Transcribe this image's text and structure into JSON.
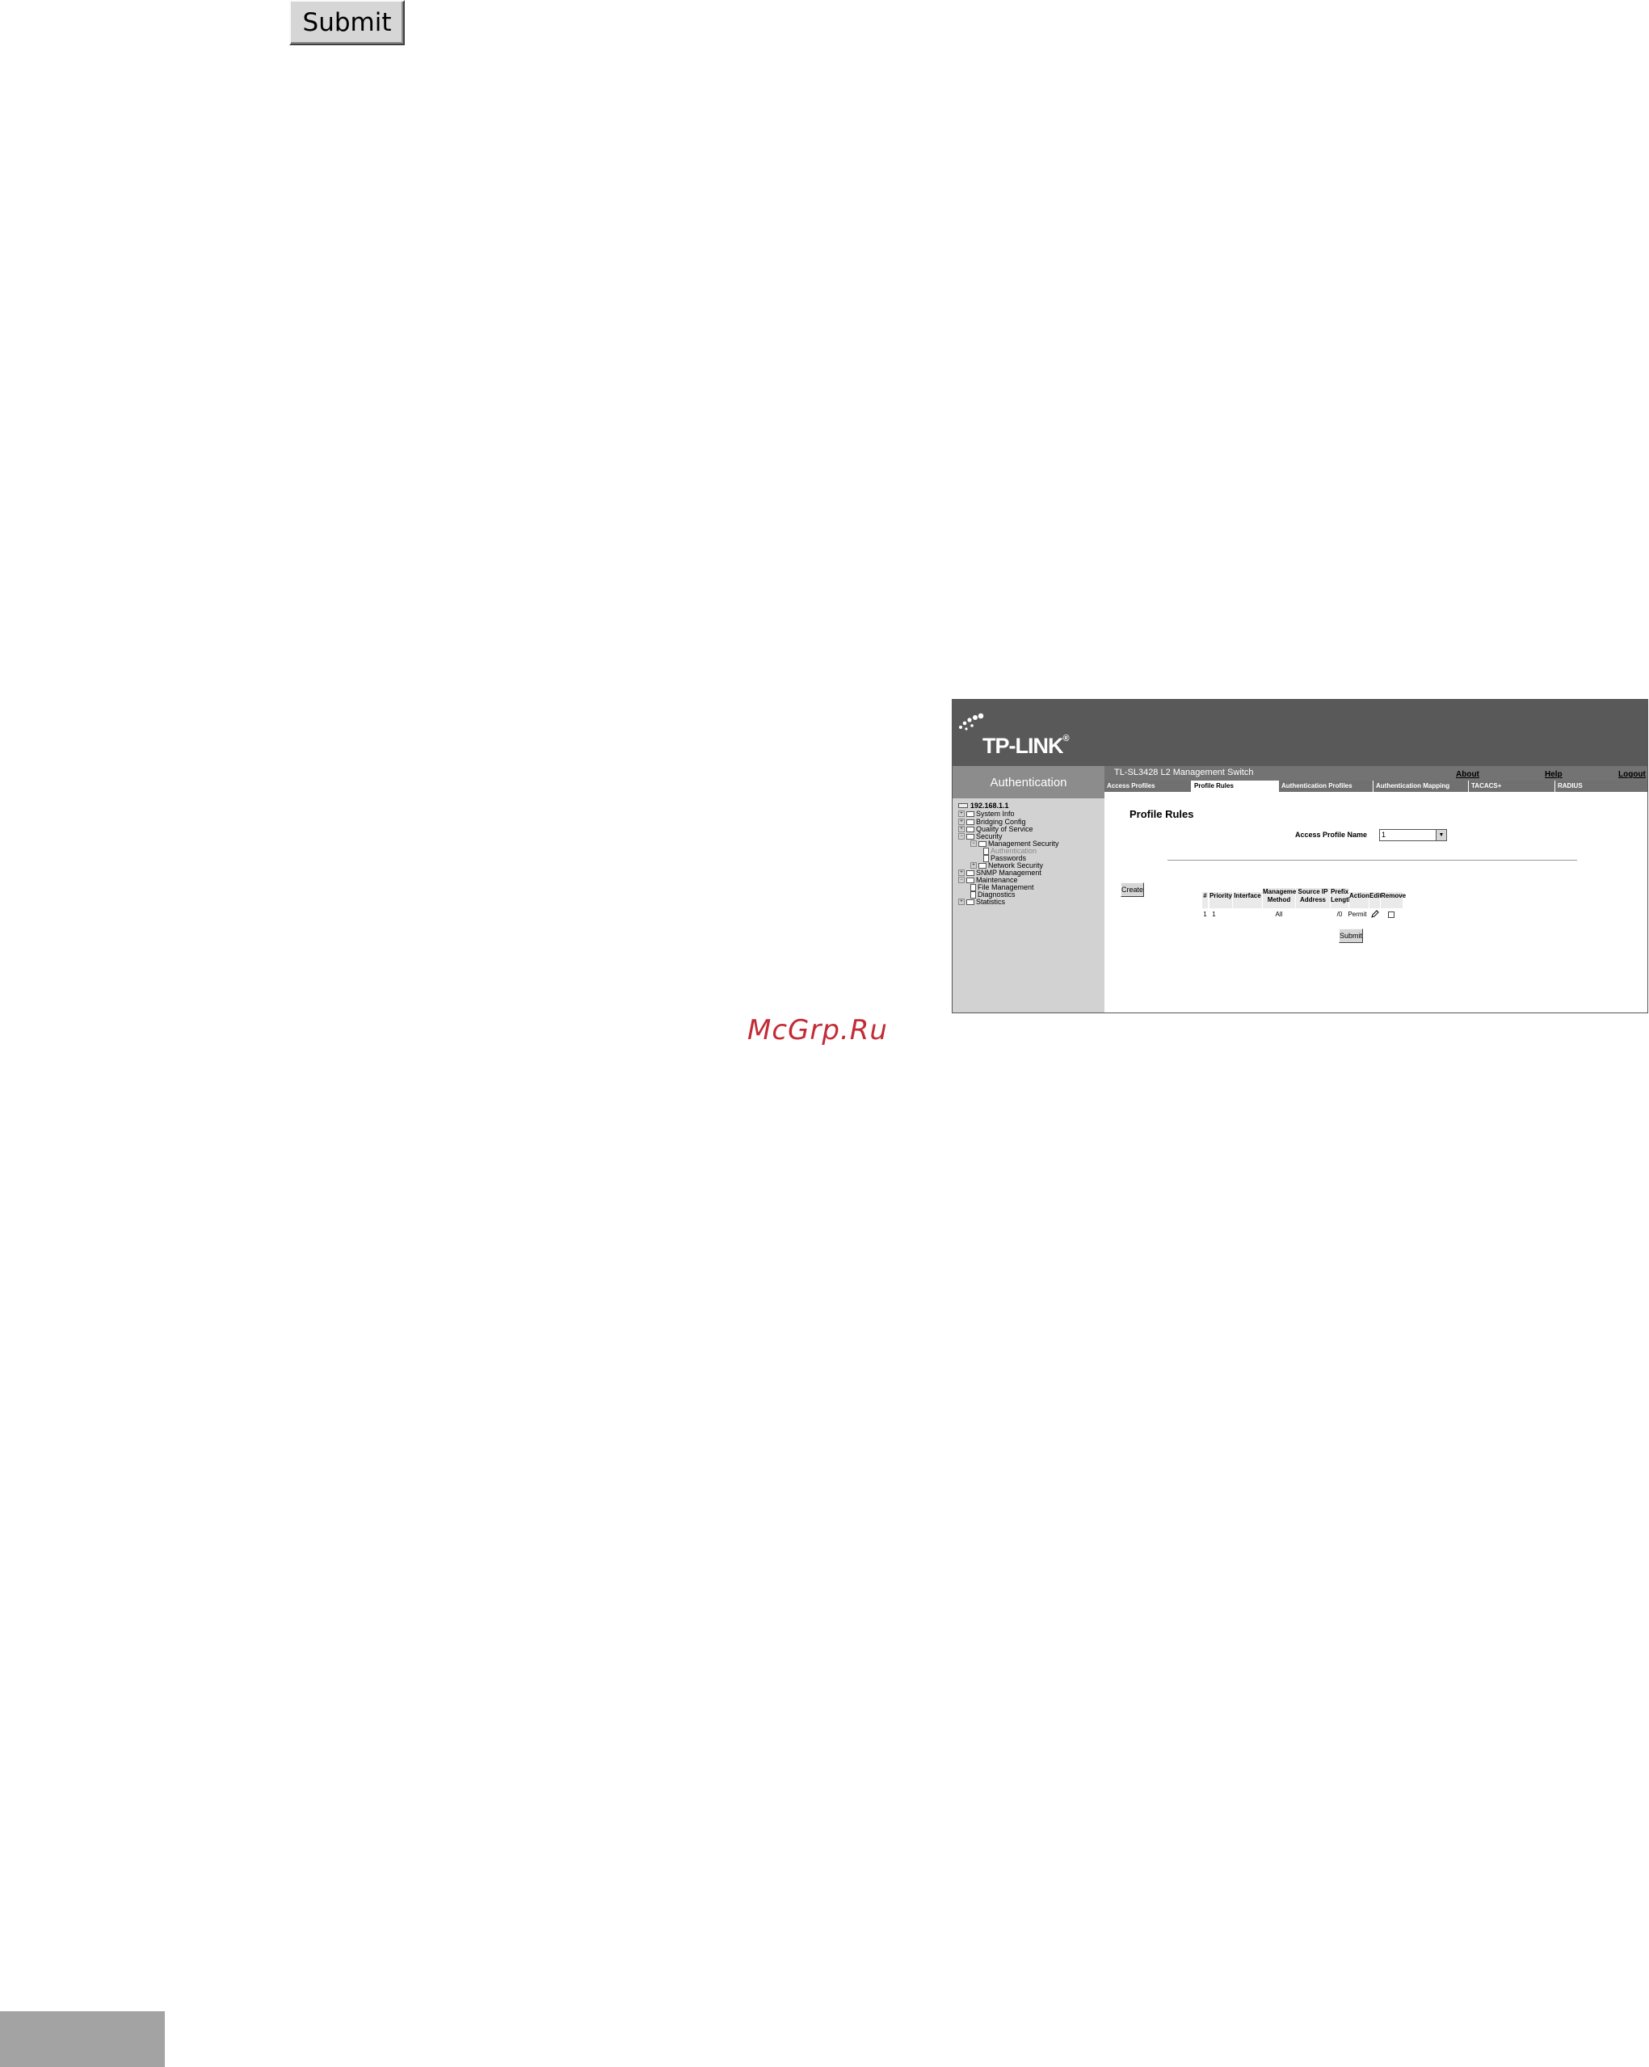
{
  "top_button": {
    "label": "Submit"
  },
  "watermark": "McGrp.Ru",
  "screenshot": {
    "logo": {
      "text": "TP-LINK",
      "mark": "®"
    },
    "nav_title": "Authentication",
    "product_name": "TL-SL3428 L2 Management Switch",
    "top_links": [
      "About",
      "Help",
      "Logout"
    ],
    "tabs": [
      "Access Profiles",
      "Profile Rules",
      "Authentication Profiles",
      "Authentication Mapping",
      "TACACS+",
      "RADIUS"
    ],
    "active_tab": "Profile Rules",
    "tree": {
      "root": "192.168.1.1",
      "items": [
        "System Info",
        "Bridging Config",
        "Quality of Service",
        "Security",
        "Management Security",
        "Authentication",
        "Passwords",
        "Network Security",
        "SNMP Management",
        "Maintenance",
        "File Management",
        "Diagnostics",
        "Statistics"
      ]
    },
    "page_title": "Profile Rules",
    "access_profile_label": "Access Profile Name",
    "access_profile_value": "1",
    "create_label": "Create",
    "table": {
      "headers": [
        "#",
        "Priority",
        "Interface",
        "Management Method",
        "Source IP Address",
        "Prefix Length",
        "Action",
        "Edit",
        "Remove"
      ],
      "rows": [
        {
          "num": "1",
          "priority": "1",
          "interface": "",
          "method": "All",
          "source_ip": "",
          "prefix": "/0",
          "action": "Permit",
          "remove": false
        }
      ]
    },
    "submit_label": "Submit"
  }
}
